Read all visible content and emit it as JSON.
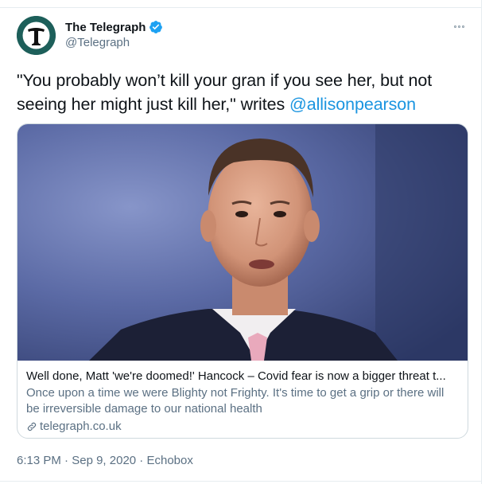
{
  "author": {
    "display_name": "The Telegraph",
    "handle": "@Telegraph",
    "verified": true,
    "avatar_letter": "T"
  },
  "tweet": {
    "text_before": "\"You probably won’t kill your gran if you see her, but not seeing her might just kill her,\" writes ",
    "mention": "@allisonpearson"
  },
  "card": {
    "title": "Well done, Matt 'we're doomed!' Hancock – Covid fear is now a bigger threat t...",
    "description": "Once upon a time we were Blighty not Frighty. It's time to get a grip or there will be irreversible damage to our national health",
    "domain": "telegraph.co.uk"
  },
  "meta": {
    "time": "6:13 PM",
    "separator1": " · ",
    "date": "Sep 9, 2020",
    "separator2": " · ",
    "source": "Echobox"
  },
  "icons": {
    "more": "more-options-icon",
    "verified": "verified-badge-icon",
    "link": "link-icon"
  },
  "colors": {
    "link_blue": "#1b95e0",
    "verified_blue": "#1da1f2",
    "secondary_text": "#5b7083",
    "avatar_bg": "#1d5f5a"
  }
}
